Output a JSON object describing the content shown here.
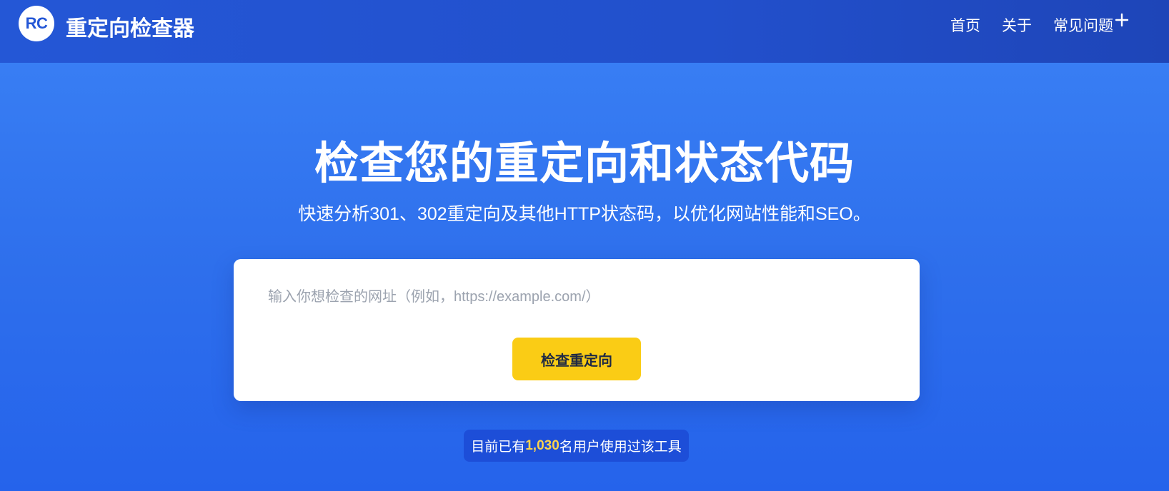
{
  "header": {
    "logo_text": "RC",
    "brand": "重定向检查器",
    "nav": [
      {
        "label": "首页"
      },
      {
        "label": "关于"
      },
      {
        "label": "常见问题"
      }
    ],
    "plus_icon": "plus-icon"
  },
  "hero": {
    "title": "检查您的重定向和状态代码",
    "subtitle": "快速分析301、302重定向及其他HTTP状态码，以优化网站性能和SEO。"
  },
  "form": {
    "url_value": "",
    "url_placeholder": "输入你想检查的网址（例如，https://example.com/）",
    "submit_label": "检查重定向"
  },
  "stats": {
    "prefix": "目前已有",
    "count": "1,030",
    "suffix": "名用户使用过该工具"
  },
  "colors": {
    "header_bg": "#2457d6",
    "hero_bg": "#3b82f6",
    "button_bg": "#facc15",
    "stats_bg": "#1d4ed8",
    "count_highlight": "#fcd34d"
  }
}
